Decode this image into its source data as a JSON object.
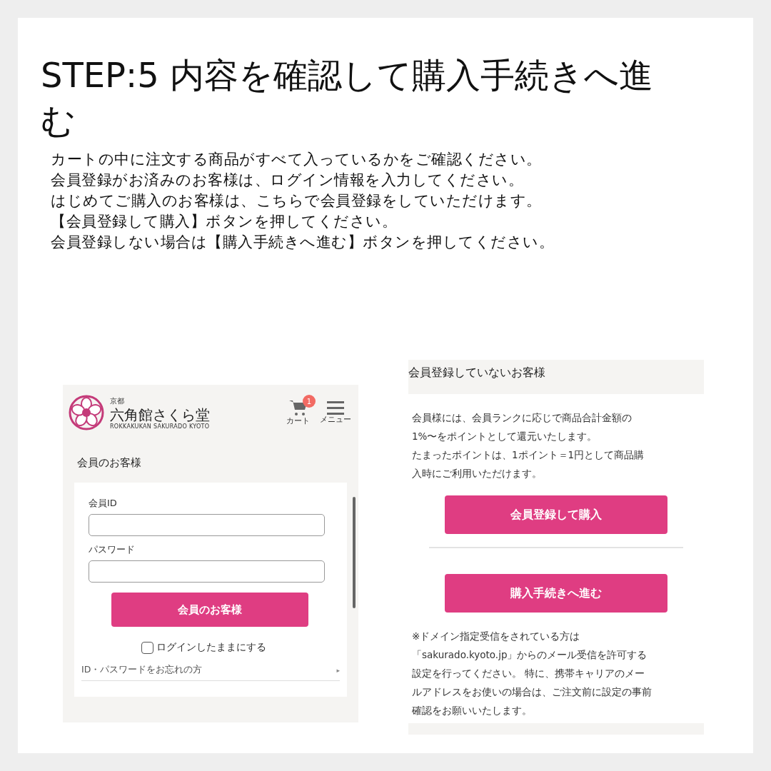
{
  "title": "STEP:5 内容を確認して購入手続きへ進む",
  "intro": [
    "カートの中に注文する商品がすべて入っているかをご確認ください。",
    "会員登録がお済みのお客様は、ログイン情報を入力してください。",
    "はじめてご購入のお客様は、こちらで会員登録をしていただけます。",
    "【会員登録して購入】ボタンを押してください。",
    "会員登録しない場合は【購入手続きへ進む】ボタンを押してください。"
  ],
  "login_screen": {
    "logo": {
      "small": "京都",
      "name": "六角館さくら堂",
      "roman": "ROKKAKUKAN SAKURADO KYOTO"
    },
    "cart": {
      "label": "カート",
      "count": "1"
    },
    "menu": {
      "label": "メニュー"
    },
    "heading": "会員のお客様",
    "fields": [
      {
        "label": "会員ID"
      },
      {
        "label": "パスワード"
      }
    ],
    "button": "会員のお客様",
    "keep_login": {
      "label": "ログインしたままにする",
      "checked": false
    },
    "forgot_link": {
      "label": "ID・パスワードをお忘れの方",
      "arrow": "▸"
    }
  },
  "guest_screen": {
    "heading": "会員登録していないお客様",
    "benefits": [
      "会員様には、会員ランクに応じで商品合計金額の",
      "1%〜をポイントとして還元いたします。",
      "たまったポイントは、1ポイント＝1円として商品購",
      "入時にご利用いただけます。"
    ],
    "register_button": "会員登録して購入",
    "checkout_button": "購入手続きへ進む",
    "notice": [
      "※ドメイン指定受信をされている方は",
      "「sakurado.kyoto.jp」からのメール受信を許可する",
      "設定を行ってください。 特に、携帯キャリアのメー",
      "ルアドレスをお使いの場合は、ご注文前に設定の事前",
      "確認をお願いいたします。"
    ]
  }
}
